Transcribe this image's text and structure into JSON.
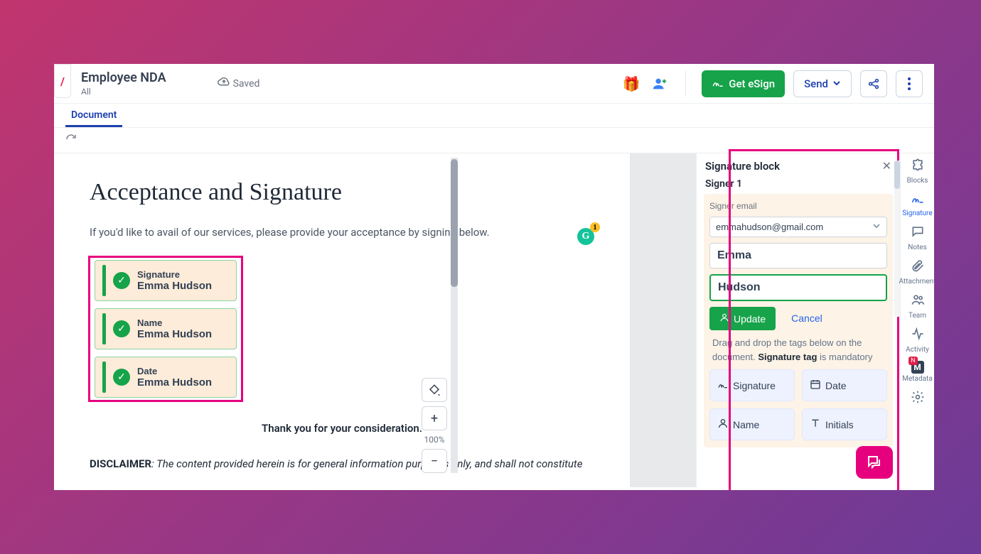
{
  "header": {
    "title": "Employee NDA",
    "subtitle": "All",
    "saved_label": "Saved",
    "get_esign": "Get eSign",
    "send": "Send"
  },
  "tabs": {
    "document": "Document"
  },
  "document": {
    "heading": "Acceptance and Signature",
    "intro": "If you'd like to avail of our services, please provide your acceptance by signing below.",
    "thanks": "Thank you for your consideration.",
    "disclaimer_label": "DISCLAIMER",
    "disclaimer_text": ": The content provided herein is for general information purposes only, and shall not constitute",
    "sig_fields": [
      {
        "label": "Signature",
        "value": "Emma Hudson"
      },
      {
        "label": "Name",
        "value": "Emma Hudson"
      },
      {
        "label": "Date",
        "value": "Emma Hudson"
      }
    ],
    "grammarly_badge": "1"
  },
  "zoom": {
    "level": "100%"
  },
  "panel": {
    "title": "Signature block",
    "signer_label": "Signer 1",
    "email_label": "Signer email",
    "email_value": "emmahudson@gmail.com",
    "first_name": "Emma",
    "last_name": "Hudson",
    "update": "Update",
    "cancel": "Cancel",
    "hint_pre": "Drag and drop the tags below on the document. ",
    "hint_bold": "Signature tag",
    "hint_post": " is mandatory",
    "tags": {
      "signature": "Signature",
      "date": "Date",
      "name": "Name",
      "initials": "Initials"
    }
  },
  "rail": {
    "blocks": "Blocks",
    "signature": "Signature",
    "notes": "Notes",
    "attachment": "Attachment",
    "team": "Team",
    "activity": "Activity",
    "metadata": "Metadata",
    "new": "N"
  }
}
